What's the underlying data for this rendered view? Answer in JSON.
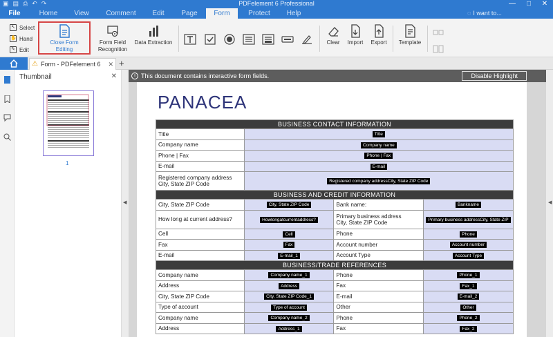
{
  "app": {
    "title": "PDFelement 6 Professional",
    "tabs": [
      "File",
      "Home",
      "View",
      "Comment",
      "Edit",
      "Page",
      "Form",
      "Protect",
      "Help"
    ],
    "active_tab": "Form",
    "search_placeholder": "I want to..."
  },
  "ribbon": {
    "select": "Select",
    "hand": "Hand",
    "edit": "Edit",
    "close_form_editing": "Close Form Editing",
    "form_field_recognition_1": "Form Field",
    "form_field_recognition_2": "Recognition",
    "data_extraction": "Data Extraction",
    "clear": "Clear",
    "import": "Import",
    "export": "Export",
    "template": "Template"
  },
  "doc_tab": {
    "title": "Form - PDFelement 6"
  },
  "thumbnail_panel": {
    "title": "Thumbnail",
    "page_number": "1"
  },
  "infobar": {
    "message": "This document contains interactive form fields.",
    "button": "Disable Highlight"
  },
  "document": {
    "brand": "PANACEA",
    "sections": {
      "contact": "BUSINESS CONTACT INFORMATION",
      "credit": "BUSINESS AND CREDIT INFORMATION",
      "trade": "BUSINESS/TRADE REFERENCES"
    },
    "contact_rows": [
      {
        "label": "Title",
        "field": "Title"
      },
      {
        "label": "Company name",
        "field": "Company name"
      },
      {
        "label": "Phone | Fax",
        "field": "Phone | Fax"
      },
      {
        "label": "E-mail",
        "field": "E-mail"
      },
      {
        "label": "Registered company address",
        "label2": "City, State ZIP Code",
        "field": "Registered company addressCity, State ZIP Code"
      }
    ],
    "credit_rows": [
      {
        "l1": "City, State ZIP Code",
        "f1": "City, State ZIP Code",
        "l2": "Bank name:",
        "f2": "Bankname"
      },
      {
        "l1": "How long at current address?",
        "f1": "Howlongatcurrentaddress?",
        "l2": "Primary business address",
        "l2b": "City, State ZIP Code",
        "f2": "Primary business addressCity, State ZIP"
      },
      {
        "l1": "Cell",
        "f1": "Cell",
        "l2": "Phone",
        "f2": "Phone"
      },
      {
        "l1": "Fax",
        "f1": "Fax",
        "l2": "Account number",
        "f2": "Account number"
      },
      {
        "l1": "E-mail",
        "f1": "E-mail_1",
        "l2": "Account Type",
        "f2": "Account Type"
      }
    ],
    "trade_rows": [
      {
        "l1": "Company name",
        "f1": "Company name_1",
        "l2": "Phone",
        "f2": "Phone_1"
      },
      {
        "l1": "Address",
        "f1": "Address",
        "l2": "Fax",
        "f2": "Fax_1"
      },
      {
        "l1": "City, State ZIP Code",
        "f1": "City, State ZIP Code_1",
        "l2": "E-mail",
        "f2": "E-mail_2"
      },
      {
        "l1": "Type of account",
        "f1": "Type of account",
        "l2": "Other",
        "f2": "Other"
      },
      {
        "l1": "Company name",
        "f1": "Company name_2",
        "l2": "Phone",
        "f2": "Phone_2"
      },
      {
        "l1": "Address",
        "f1": "Address_1",
        "l2": "Fax",
        "f2": "Fax_2"
      }
    ]
  },
  "colors": {
    "accent": "#2f7ad0",
    "highlight_border": "#d64545",
    "field_fill": "#d9dcf4",
    "brand": "#2e3479",
    "section_header": "#3c3c3c"
  }
}
